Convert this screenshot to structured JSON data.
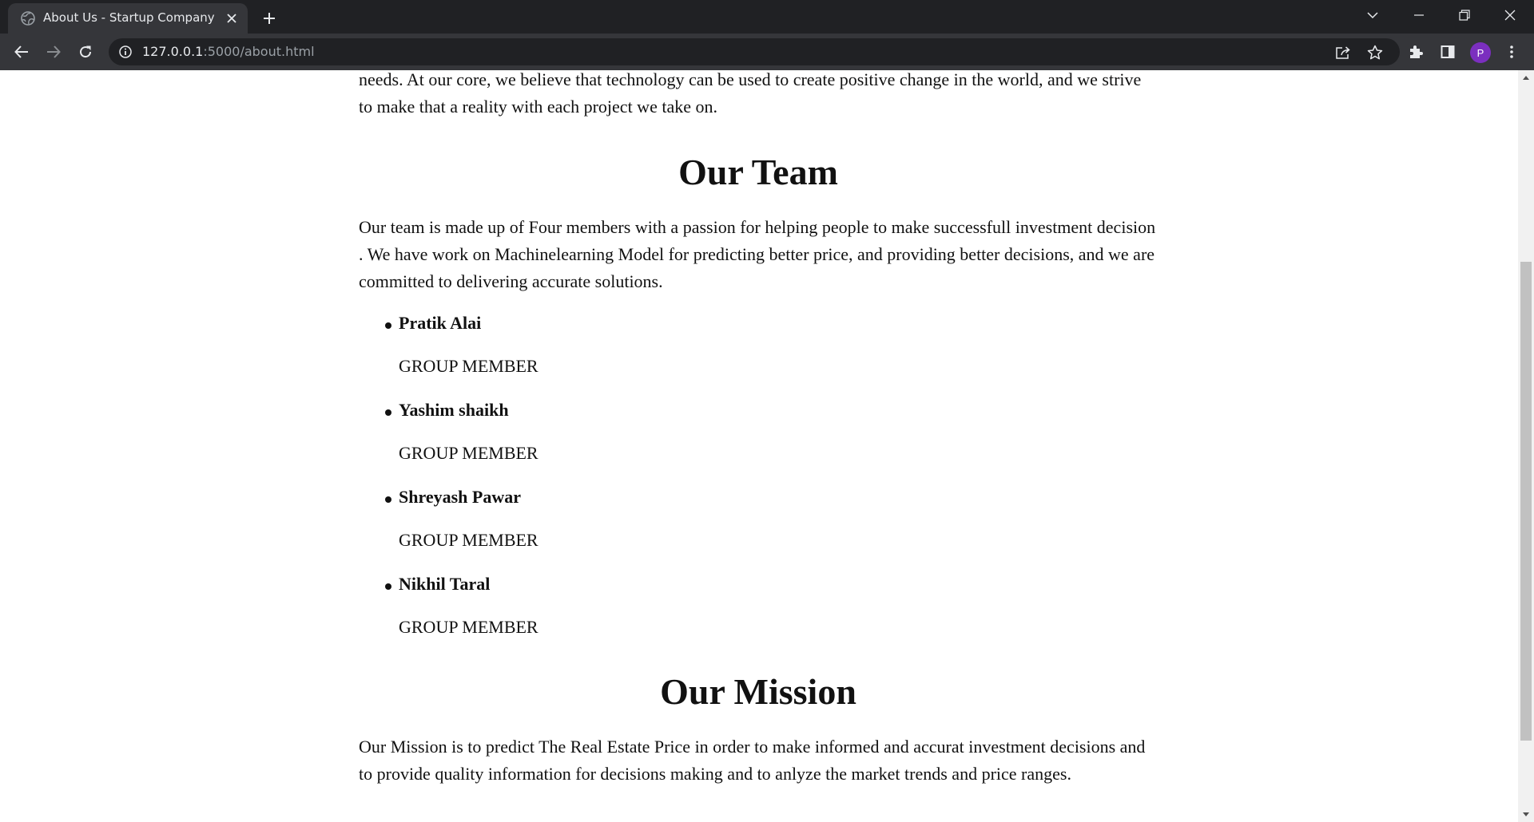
{
  "browser": {
    "tab": {
      "title": "About Us - Startup Company",
      "favicon": "globe-icon"
    },
    "address_bar": {
      "host": "127.0.0.1",
      "path": ":5000/about.html"
    },
    "profile_initial": "P",
    "colors": {
      "titlebar": "#202124",
      "toolbar": "#35363a",
      "avatar": "#7b2fbf"
    }
  },
  "page": {
    "intro_text": "needs. At our core, we believe that technology can be used to create positive change in the world, and we strive to make that a reality with each project we take on.",
    "team": {
      "heading": "Our Team",
      "description": "Our team is made up of Four members with a passion for helping people to make successfull investment decision . We have work on Machinelearning Model for predicting better price, and providing better decisions, and we are committed to delivering accurate solutions.",
      "members": [
        {
          "name": "Pratik Alai",
          "role": "GROUP MEMBER"
        },
        {
          "name": "Yashim shaikh",
          "role": "GROUP MEMBER"
        },
        {
          "name": "Shreyash Pawar",
          "role": "GROUP MEMBER"
        },
        {
          "name": "Nikhil Taral",
          "role": "GROUP MEMBER"
        }
      ]
    },
    "mission": {
      "heading": "Our Mission",
      "text": "Our Mission is to predict The Real Estate Price in order to make informed and accurat investment decisions and to provide quality information for decisions making and to anlyze the market trends and price ranges."
    }
  }
}
